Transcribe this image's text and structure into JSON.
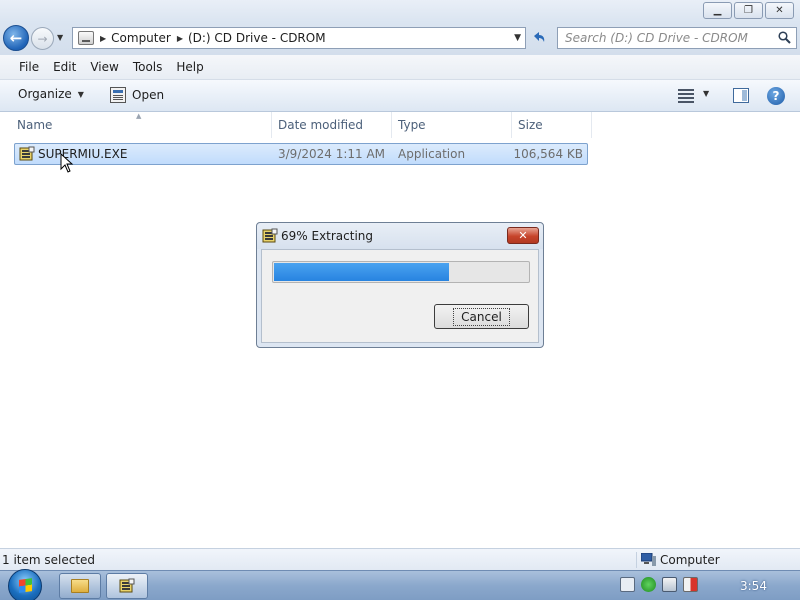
{
  "window": {
    "minimize_label": "▁",
    "maximize_label": "❐",
    "close_label": "✕"
  },
  "address": {
    "segments": [
      "Computer",
      "(D:) CD Drive - CDROM"
    ],
    "search_placeholder": "Search (D:) CD Drive - CDROM"
  },
  "menu": {
    "items": [
      "File",
      "Edit",
      "View",
      "Tools",
      "Help"
    ]
  },
  "toolbar": {
    "organize_label": "Organize",
    "open_label": "Open"
  },
  "columns": {
    "name": "Name",
    "date_modified": "Date modified",
    "type": "Type",
    "size": "Size"
  },
  "files": [
    {
      "name": "SUPERMIU.EXE",
      "date_modified": "3/9/2024 1:11 AM",
      "type": "Application",
      "size": "106,564 KB",
      "selected": true
    }
  ],
  "dialog": {
    "title": "69% Extracting",
    "progress": 0.69,
    "cancel_label": "Cancel",
    "close_label": "✕"
  },
  "status": {
    "selection_text": "1 item selected",
    "location_text": "Computer"
  },
  "taskbar": {
    "clock": "3:54"
  },
  "colors": {
    "progress_fill": "#2783e0",
    "selection": "#c1dcfc",
    "close_button": "#c7442b"
  },
  "icons": {
    "back": "back-arrow-icon",
    "forward": "forward-arrow-icon",
    "refresh": "refresh-icon",
    "search": "search-icon",
    "help": "help-icon",
    "app": "installer-app-icon"
  }
}
